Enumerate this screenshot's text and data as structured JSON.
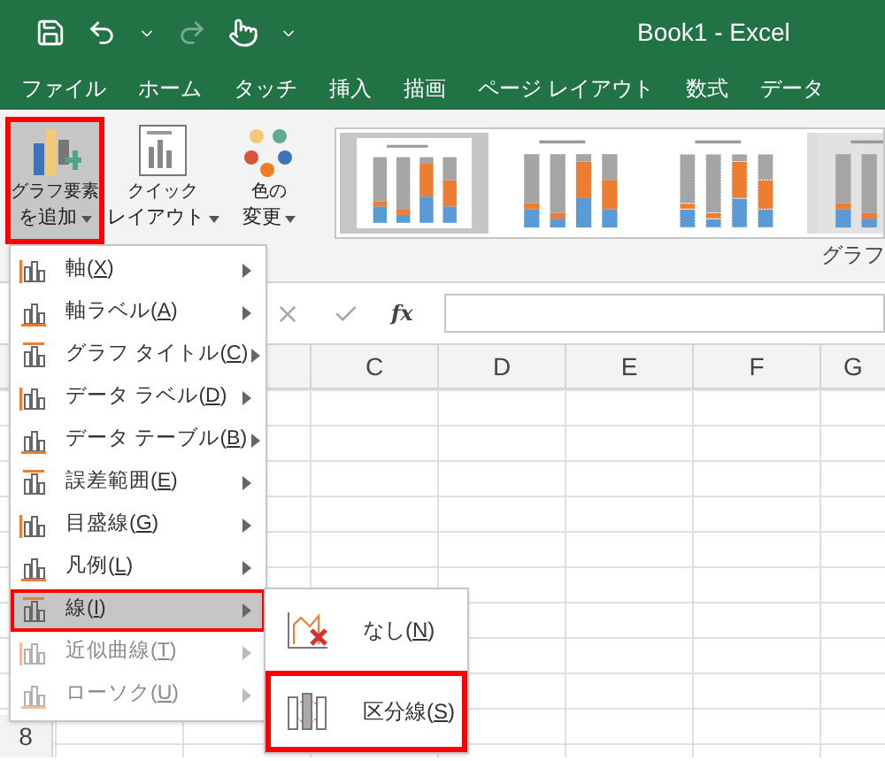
{
  "window": {
    "title": "Book1 - Excel"
  },
  "tabs": [
    {
      "label": "ファイル"
    },
    {
      "label": "ホーム"
    },
    {
      "label": "タッチ"
    },
    {
      "label": "挿入"
    },
    {
      "label": "描画"
    },
    {
      "label": "ページ レイアウト"
    },
    {
      "label": "数式"
    },
    {
      "label": "データ"
    }
  ],
  "ribbon": {
    "buttons": [
      {
        "line1": "グラフ要素",
        "line2": "を追加",
        "highlighted": true,
        "selected": true
      },
      {
        "line1": "クイック",
        "line2": "レイアウト",
        "highlighted": false,
        "selected": false
      },
      {
        "line1": "色の",
        "line2": "変更",
        "highlighted": false,
        "selected": false
      }
    ],
    "styles": [
      {
        "selected": true
      },
      {
        "selected": false
      },
      {
        "selected": false
      },
      {
        "selected": false
      }
    ],
    "group_label": "グラフ"
  },
  "formula_bar": {
    "function_label": "fx"
  },
  "sheet": {
    "columns": [
      "C",
      "D",
      "E",
      "F",
      "G"
    ],
    "row_headers": [
      "8"
    ]
  },
  "menu": [
    {
      "before": "軸(",
      "key": "X",
      "after": ")",
      "disabled": false,
      "selected": false,
      "highlighted": false
    },
    {
      "before": "軸ラベル(",
      "key": "A",
      "after": ")",
      "disabled": false,
      "selected": false,
      "highlighted": false
    },
    {
      "before": "グラフ タイトル(",
      "key": "C",
      "after": ")",
      "disabled": false,
      "selected": false,
      "highlighted": false
    },
    {
      "before": "データ ラベル(",
      "key": "D",
      "after": ")",
      "disabled": false,
      "selected": false,
      "highlighted": false
    },
    {
      "before": "データ テーブル(",
      "key": "B",
      "after": ")",
      "disabled": false,
      "selected": false,
      "highlighted": false
    },
    {
      "before": "誤差範囲(",
      "key": "E",
      "after": ")",
      "disabled": false,
      "selected": false,
      "highlighted": false
    },
    {
      "before": "目盛線(",
      "key": "G",
      "after": ")",
      "disabled": false,
      "selected": false,
      "highlighted": false
    },
    {
      "before": "凡例(",
      "key": "L",
      "after": ")",
      "disabled": false,
      "selected": false,
      "highlighted": false
    },
    {
      "before": "線(",
      "key": "I",
      "after": ")",
      "disabled": false,
      "selected": true,
      "highlighted": true
    },
    {
      "before": "近似曲線(",
      "key": "T",
      "after": ")",
      "disabled": true,
      "selected": false,
      "highlighted": false
    },
    {
      "before": "ローソク(",
      "key": "U",
      "after": ")",
      "disabled": true,
      "selected": false,
      "highlighted": false
    }
  ],
  "submenu": [
    {
      "before": "なし(",
      "key": "N",
      "after": ")",
      "highlighted": false
    },
    {
      "before": "区分線(",
      "key": "S",
      "after": ")",
      "highlighted": true
    }
  ]
}
